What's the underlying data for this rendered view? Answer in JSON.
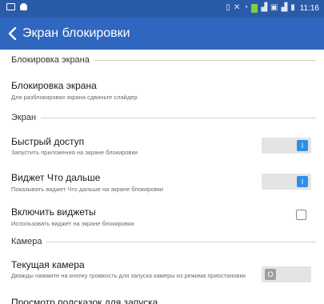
{
  "statusbar": {
    "time": "11:16"
  },
  "appbar": {
    "title": "Экран блокировки"
  },
  "sections": {
    "lock": "Блокировка экрана",
    "screen": "Экран",
    "camera": "Камера"
  },
  "items": {
    "lock_screen": {
      "title": "Блокировка экрана",
      "subtitle": "Для разблокировки экрана сдвиньте слайдер"
    },
    "quick_access": {
      "title": "Быстрый доступ",
      "subtitle": "Запустить приложения на экране блокировки",
      "toggle_state": "I"
    },
    "what_next": {
      "title": "Виджет Что дальше",
      "subtitle": "Показывать виджет Что дальше на экране блокировки",
      "toggle_state": "I"
    },
    "enable_widgets": {
      "title": "Включить виджеты",
      "subtitle": "Использовать виджет на экране блокировки",
      "checked": false
    },
    "current_camera": {
      "title": "Текущая камера",
      "subtitle": "Дважды нажмите на кнопку громкость для запуска камеры из режима приостановки",
      "toggle_state": "O"
    },
    "cutoff_item": {
      "title": "Просмотр подсказок для запуска"
    }
  },
  "colors": {
    "statusbar": "#2a5ba8",
    "appbar": "#2f66bf",
    "toggle_on": "#2e8ee8",
    "toggle_off": "#9e9e9e"
  }
}
